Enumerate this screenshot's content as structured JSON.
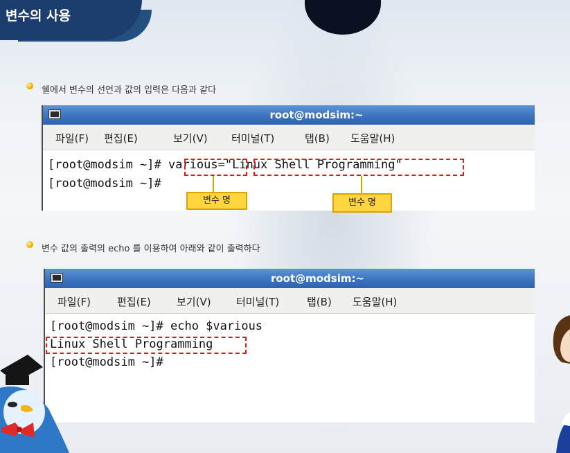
{
  "page": {
    "title": "변수의 사용",
    "bullet1": "쉘에서 변수의 선언과 값의 입력은 다음과 같다",
    "bullet2": "변수 값의 출력의 echo 를 이용하여 아래와 같이 출력하다"
  },
  "terminal1": {
    "title": "root@modsim:~",
    "menu": [
      "파일(F)",
      "편집(E)",
      "보기(V)",
      "터미널(T)",
      "탭(B)",
      "도움말(H)"
    ],
    "lines": [
      "[root@modsim ~]# various=\"Linux Shell Programming\"",
      "[root@modsim ~]#"
    ],
    "callout_left": "변수 명",
    "callout_right": "변수 명"
  },
  "terminal2": {
    "title": "root@modsim:~",
    "menu": [
      "파일(F)",
      "편집(E)",
      "보기(V)",
      "터미널(T)",
      "탭(B)",
      "도움말(H)"
    ],
    "lines": [
      "[root@modsim ~]# echo $various",
      "Linux Shell Programming",
      "[root@modsim ~]#"
    ]
  },
  "colors": {
    "banner": "#1b3e6e",
    "titlebar": "#3b73c0",
    "highlight_box": "#e01818",
    "callout": "#ffd640",
    "bullet": "#f2b200"
  },
  "icons": [
    "terminal-icon",
    "bullet-icon",
    "penguin-mascot",
    "character-mascot"
  ]
}
